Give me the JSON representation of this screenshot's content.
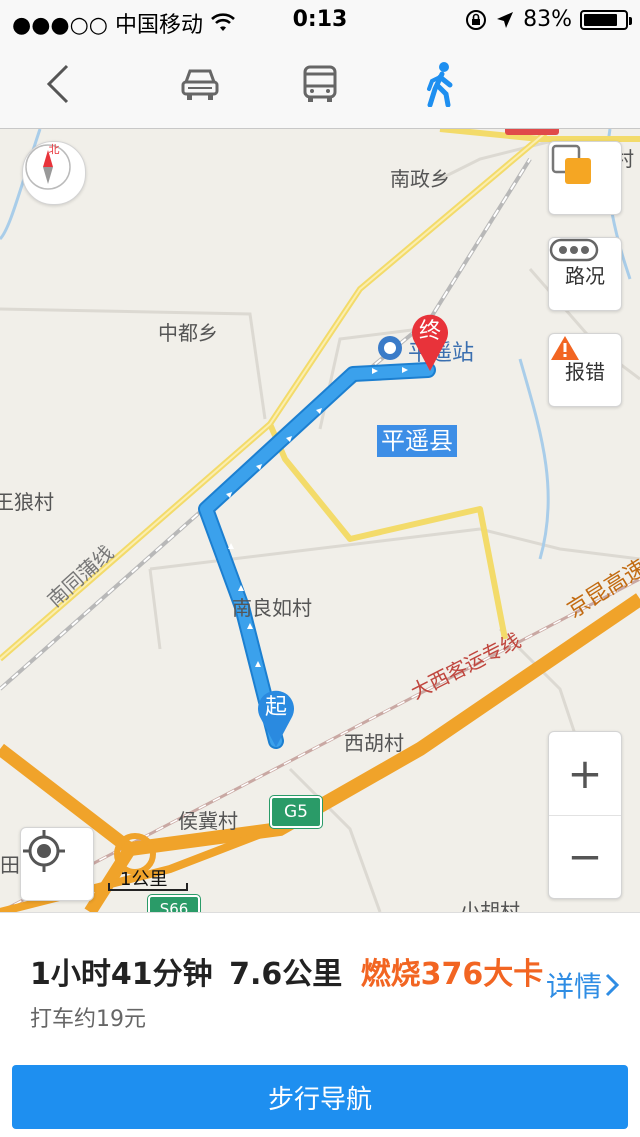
{
  "status_bar": {
    "carrier": "●●●○○ 中国移动",
    "time": "0:13",
    "battery": "83%",
    "battery_level": 0.83
  },
  "nav": {
    "back_icon": "chevron-left-icon",
    "modes": [
      {
        "name": "car-icon",
        "selected": false
      },
      {
        "name": "bus-icon",
        "selected": false
      },
      {
        "name": "walk-icon",
        "selected": true
      }
    ],
    "accent_color": "#1e8ff0"
  },
  "map": {
    "labels": {
      "nanzheng": "南政乡",
      "cun_edge": "村",
      "zhongdu": "中都乡",
      "station": "平遥站",
      "county": "平遥县",
      "wanglang": "王狼村",
      "nantongpu": "南同蒲线",
      "nanliangru": "南良如村",
      "datai": "大西客运专线",
      "jingkun": "京昆高速",
      "xihu": "西胡村",
      "houji": "侯冀村",
      "tian": "田",
      "xiaohu": "小胡村",
      "g5": "G5",
      "s66": "S66"
    },
    "start_marker": "起",
    "end_marker": "终",
    "compass_label": "北",
    "traffic_label": "路况",
    "report_label": "报错",
    "zoom_in": "+",
    "zoom_out": "−",
    "scale_label": "1公里",
    "route_color": "#3ba1ec"
  },
  "route_summary": {
    "duration": "1小时41分钟",
    "distance": "7.6公里",
    "calories": "燃烧376大卡",
    "taxi": "打车约19元",
    "detail_label": "详情",
    "start_button": "步行导航"
  }
}
